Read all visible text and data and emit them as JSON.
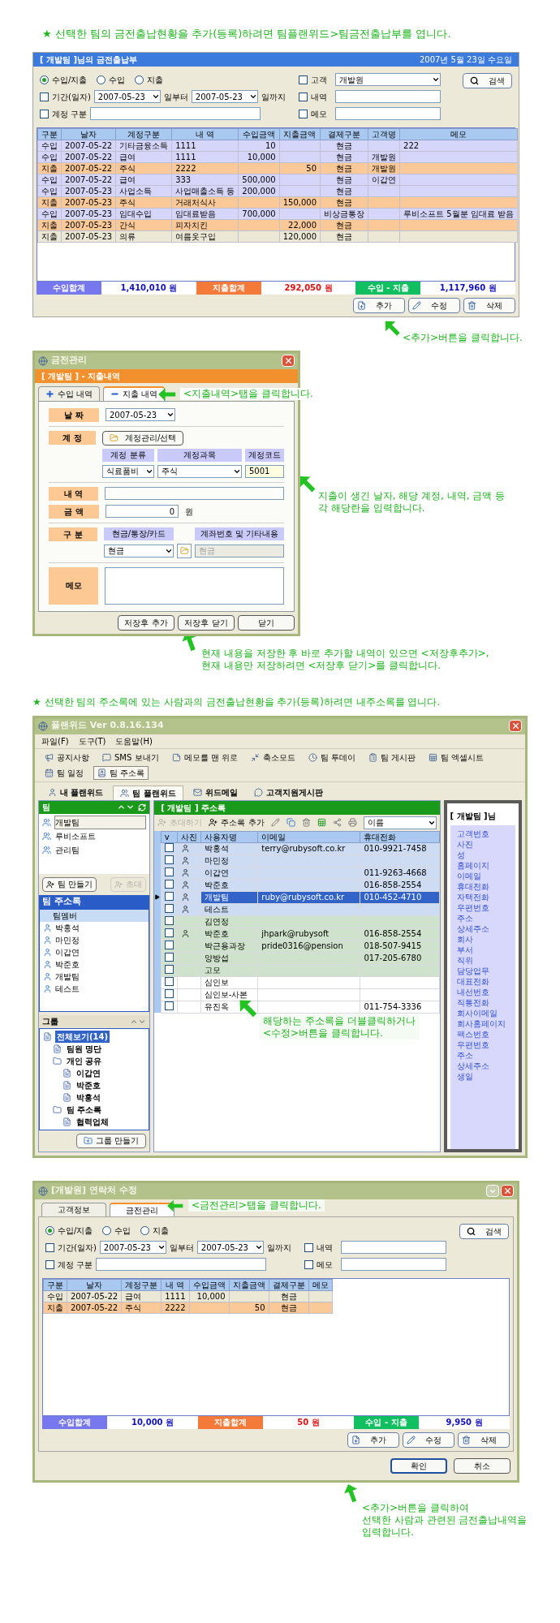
{
  "heading_1": "★ 선택한 팀의 금전출납현황을 추가(등록)하려면 팀플랜위드>팀금전출납부를 엽니다.",
  "ledger": {
    "title": "[ 개발팀 ]님의 금전출납부",
    "date": "2007년 5월 23일 수요일",
    "filters": {
      "radios": [
        {
          "label": "수입/지출",
          "selected": true
        },
        {
          "label": "수입",
          "selected": false
        },
        {
          "label": "지출",
          "selected": false
        }
      ],
      "period": {
        "label": "기간(일자)",
        "checked": false,
        "from": "2007-05-23",
        "from_suffix": "일부터",
        "to": "2007-05-23",
        "to_suffix": "일까지"
      },
      "account": {
        "label": "계정 구분",
        "checked": false
      },
      "extra": [
        {
          "label": "고객",
          "checked": false,
          "kind": "select",
          "value": "개발원"
        },
        {
          "label": "내역",
          "checked": false,
          "kind": "input"
        },
        {
          "label": "메모",
          "checked": false,
          "kind": "input"
        }
      ],
      "search": "검색"
    },
    "columns": [
      "구분",
      "날자",
      "계정구분",
      "내 역",
      "수입금액",
      "지출금액",
      "결제구분",
      "고객명",
      "메모"
    ],
    "rows": [
      {
        "kind": "income",
        "type": "수입",
        "date": "2007-05-22",
        "account": "기타금융소득",
        "detail": "1111",
        "income": "10",
        "payment": "현금",
        "memo": "222"
      },
      {
        "kind": "income",
        "type": "수입",
        "date": "2007-05-22",
        "account": "급여",
        "detail": "1111",
        "income": "10,000",
        "payment": "현금",
        "customer": "개발원"
      },
      {
        "kind": "expense",
        "type": "지출",
        "date": "2007-05-22",
        "account": "주식",
        "detail": "2222",
        "expense": "50",
        "payment": "현금",
        "customer": "개발원"
      },
      {
        "kind": "income",
        "type": "수입",
        "date": "2007-05-22",
        "account": "급여",
        "detail": "333",
        "income": "500,000",
        "payment": "현금",
        "customer": "이갑연"
      },
      {
        "kind": "income",
        "type": "수입",
        "date": "2007-05-23",
        "account": "사업소득",
        "detail": "사업매출소득 등",
        "income": "200,000",
        "payment": "현금"
      },
      {
        "kind": "expense",
        "type": "지출",
        "date": "2007-05-23",
        "account": "주식",
        "detail": "거래처식사",
        "expense": "150,000",
        "payment": "현금"
      },
      {
        "kind": "income",
        "type": "수입",
        "date": "2007-05-23",
        "account": "임대수입",
        "detail": "임대료받음",
        "income": "700,000",
        "payment": "비상금통장",
        "memo": "루비소프트 5월분 임대료 받음"
      },
      {
        "kind": "expense",
        "type": "지출",
        "date": "2007-05-23",
        "account": "간식",
        "detail": "피자치킨",
        "expense": "22,000",
        "payment": "현금"
      },
      {
        "kind": "current",
        "type": "지출",
        "date": "2007-05-23",
        "account": "의류",
        "detail": "여름옷구입",
        "expense": "120,000",
        "payment": "현금"
      }
    ],
    "totals": [
      {
        "kind": "income",
        "label": "수입합계",
        "value": "1,410,010 원"
      },
      {
        "kind": "expense",
        "label": "지출합계",
        "value": "292,050 원"
      },
      {
        "kind": "balance",
        "label": "수입 - 지출",
        "value": "1,117,960 원"
      }
    ],
    "buttons": [
      {
        "kind": "add",
        "label": "추가"
      },
      {
        "kind": "edit",
        "label": "수정"
      },
      {
        "kind": "delete",
        "label": "삭제"
      }
    ]
  },
  "callout_add": "<추가>버튼을 클릭합니다.",
  "expense_dialog": {
    "title": "금전관리",
    "header": "[ 개발팀 ] - 지출내역",
    "tabs": [
      {
        "label": "수입 내역",
        "selected": false,
        "kind": "plus"
      },
      {
        "label": "지출 내역",
        "selected": true,
        "kind": "minus"
      }
    ],
    "date": {
      "label": "날 짜",
      "value": "2007-05-23"
    },
    "account": {
      "label": "계 정",
      "button": "계정관리/선택",
      "columns": [
        "계정 분류",
        "계정과목",
        "계정코드"
      ],
      "category": "식료품비",
      "subject": "주식",
      "code": "5001"
    },
    "detail": {
      "label": "내 역"
    },
    "amount": {
      "label": "금 액",
      "value": "0",
      "unit": "원"
    },
    "payment": {
      "label": "구 분",
      "columns": [
        "현금/통장/카드",
        "계좌번호 및 기타내용"
      ],
      "method": "현금",
      "note": "현금"
    },
    "memo": {
      "label": "메모"
    },
    "buttons": [
      "저장후 추가",
      "저장후 닫기",
      "닫기"
    ]
  },
  "callout_tab": "<지출내역>탭을 클릭합니다.",
  "callout_fields": "지출이 생긴 날자, 해당 계정, 내역, 금액 등\n각 해당란을 입력합니다.",
  "callout_save": "현재 내용을 저장한 후 바로 추가할 내역이 있으면 <저장후추가>,\n현재 내용만 저장하려면 <저장후 닫기>를 클릭합니다.",
  "heading_2": "★ 선택한 팀의 주소록에 있는 사람과의 금전출납현황을 추가(등록)하려면 내주소록를 엽니다.",
  "address_window": {
    "title": "플랜위드 Ver 0.8.16.134",
    "menu": [
      "파일(F)",
      "도구(T)",
      "도움말(H)"
    ],
    "toolbar": [
      {
        "label": "공지사항",
        "selected": false
      },
      {
        "label": "SMS 보내기",
        "selected": false
      },
      {
        "label": "메모를 맨 위로",
        "selected": false
      },
      {
        "label": "축소모드",
        "selected": false
      },
      {
        "label": "팀 투데이",
        "selected": false
      },
      {
        "label": "팀 게시판",
        "selected": false
      },
      {
        "label": "팀 엑셀시트",
        "selected": false
      },
      {
        "label": "팀 일정",
        "selected": false
      },
      {
        "label": "팀 주소록",
        "selected": true
      }
    ],
    "tabs": [
      {
        "label": "내 플랜위드",
        "selected": false
      },
      {
        "label": "팀 플랜위드",
        "selected": true
      },
      {
        "label": "위드메일",
        "selected": false
      },
      {
        "label": "고객지원게시판",
        "selected": false
      }
    ],
    "teams": {
      "header": "팀",
      "items": [
        {
          "label": "개발팀",
          "selected": true
        },
        {
          "label": "루비소프트",
          "selected": false
        },
        {
          "label": "관리팀",
          "selected": false
        }
      ],
      "buttons": [
        {
          "label": "팀 만들기",
          "disabled": false
        },
        {
          "label": "초대",
          "disabled": true
        }
      ]
    },
    "team_address": {
      "header": "팀 주소록",
      "column": "팀멤버",
      "members": [
        "박홍석",
        "마민정",
        "이갑연",
        "박준호",
        "개발팀",
        "테스트"
      ]
    },
    "groups": {
      "header": "그룹",
      "tree": [
        {
          "label": "전체보기(14)",
          "selected": true,
          "children": [
            {
              "label": "팀원 명단",
              "selected": false
            },
            {
              "label": "개인 공유",
              "selected": false,
              "children": [
                {
                  "label": "이갑연",
                  "selected": false
                },
                {
                  "label": "박준호",
                  "selected": false
                },
                {
                  "label": "박홍석",
                  "selected": false
                }
              ]
            },
            {
              "label": "팀 주소록",
              "selected": false,
              "children": [
                {
                  "label": "협력업체",
                  "selected": false
                }
              ]
            }
          ]
        }
      ],
      "button": "그룹 만들기"
    },
    "address_book": {
      "header": "[ 개발팀 ] 주소록",
      "toolbar": [
        {
          "label": "초대하기",
          "disabled": true
        },
        {
          "label": "주소록 추가",
          "disabled": false
        }
      ],
      "sort": "이름",
      "columns": [
        "v",
        "사진",
        "사용자명",
        "이메일",
        "휴대전화"
      ],
      "rows": [
        {
          "name": "박홍석",
          "email": "terry@rubysoft.co.kr",
          "phone": "010-9921-7458",
          "photo": true,
          "checked": false,
          "selected": false,
          "color": "#cddcf2"
        },
        {
          "name": "마민정",
          "photo": true,
          "checked": false,
          "selected": false,
          "color": "#cddcf2"
        },
        {
          "name": "이갑연",
          "phone": "011-9263-4668",
          "photo": true,
          "checked": false,
          "selected": false,
          "color": "#cddcf2"
        },
        {
          "name": "박준호",
          "phone": "016-858-2554",
          "photo": true,
          "checked": false,
          "selected": false,
          "color": "#cddcf2"
        },
        {
          "name": "개발팀",
          "email": "ruby@rubysoft.co.kr",
          "phone": "010-452-4710",
          "photo": true,
          "checked": false,
          "selected": true,
          "color": "#cddcf2"
        },
        {
          "name": "테스트",
          "photo": true,
          "checked": false,
          "selected": false,
          "color": "#cddcf2"
        },
        {
          "name": "김연정",
          "photo": false,
          "checked": false,
          "selected": false,
          "color": "#cfe3cc"
        },
        {
          "name": "박준호",
          "email": "jhpark@rubysoft",
          "phone": "016-858-2554",
          "photo": true,
          "checked": false,
          "selected": false,
          "color": "#cfe3cc"
        },
        {
          "name": "박근용과장",
          "email": "pride0316@pension",
          "phone": "018-507-9415",
          "photo": false,
          "checked": false,
          "selected": false,
          "color": "#cfe3cc"
        },
        {
          "name": "양방섭",
          "phone": "017-205-6780",
          "photo": false,
          "checked": false,
          "selected": false,
          "color": "#cfe3cc"
        },
        {
          "name": "고모",
          "photo": false,
          "checked": false,
          "selected": false,
          "color": "#cfe3cc"
        },
        {
          "name": "심인보",
          "photo": false,
          "checked": false,
          "selected": false,
          "color": "#ffffff"
        },
        {
          "name": "심인보-사본",
          "photo": false,
          "checked": false,
          "selected": false,
          "color": "#ffffff"
        },
        {
          "name": "유진옥",
          "phone": "011-754-3336",
          "photo": false,
          "checked": false,
          "selected": false,
          "color": "#ffffff"
        }
      ]
    },
    "detail_panel": {
      "header": "[ 개발팀 ]님",
      "fields": [
        "고객번호",
        "사진",
        "성",
        "홈페이지",
        "이메일",
        "휴대전화",
        "자택전화",
        "우편번호",
        "주소",
        "상세주소",
        "회사",
        "부서",
        "직위",
        "담당업무",
        "대표전화",
        "내선번호",
        "직통전화",
        "회사이메일",
        "회사홈페이지",
        "팩스번호",
        "우편번호",
        "주소",
        "상세주소",
        "생일"
      ]
    }
  },
  "callout_row": "해당하는 주소록을 더블클릭하거나\n<수정>버튼을 클릭합니다.",
  "contact_window": {
    "title": "[개발원] 연락처 수정",
    "tabs": [
      {
        "label": "고객정보",
        "selected": false
      },
      {
        "label": "금전관리",
        "selected": true
      }
    ],
    "ledger": {
      "filters": {
        "radios": [
          {
            "label": "수입/지출",
            "selected": true
          },
          {
            "label": "수입",
            "selected": false
          },
          {
            "label": "지출",
            "selected": false
          }
        ],
        "period": {
          "label": "기간(일자)",
          "checked": false,
          "from": "2007-05-23",
          "from_suffix": "일부터",
          "to": "2007-05-23",
          "to_suffix": "일까지"
        },
        "account": {
          "label": "계정 구분",
          "checked": false
        },
        "extra": [
          {
            "label": "내역",
            "checked": false,
            "kind": "input"
          },
          {
            "label": "메모",
            "checked": false,
            "kind": "input"
          }
        ],
        "search": "검색"
      },
      "columns": [
        "구분",
        "날자",
        "계정구분",
        "내 역",
        "수입금액",
        "지출금액",
        "결제구분",
        "메모"
      ],
      "rows": [
        {
          "kind": "current",
          "type": "수입",
          "date": "2007-05-22",
          "account": "급여",
          "detail": "1111",
          "income": "10,000",
          "payment": "현금"
        },
        {
          "kind": "expense",
          "type": "지출",
          "date": "2007-05-22",
          "account": "주식",
          "detail": "2222",
          "expense": "50",
          "payment": "현금"
        }
      ],
      "totals": [
        {
          "kind": "income",
          "label": "수입합계",
          "value": "10,000 원"
        },
        {
          "kind": "expense",
          "label": "지출합계",
          "value": "50 원"
        },
        {
          "kind": "balance",
          "label": "수입 - 지출",
          "value": "9,950 원"
        }
      ],
      "buttons": [
        {
          "kind": "add",
          "label": "추가"
        },
        {
          "kind": "edit",
          "label": "수정"
        },
        {
          "kind": "delete",
          "label": "삭제"
        }
      ]
    },
    "buttons": [
      "확인",
      "취소"
    ]
  },
  "callout_contact_tab": "<금전관리>탭을 클릭합니다.",
  "callout_contact_add": "<추가>버튼을 클릭하여\n선택한 사람과 관련된 금전출납내역을\n입력합니다."
}
